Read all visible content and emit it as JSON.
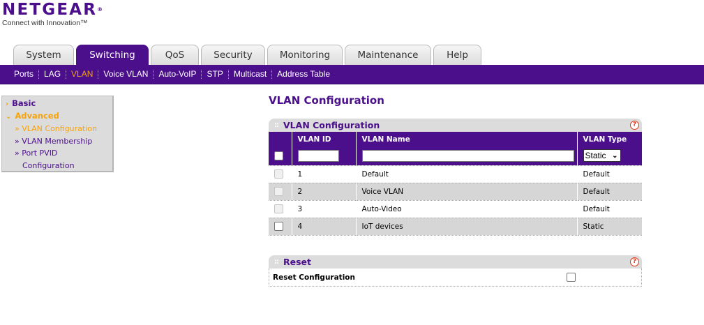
{
  "brand": {
    "name": "NETGEAR",
    "tagline": "Connect with Innovation™"
  },
  "tabs": [
    {
      "label": "System",
      "active": false
    },
    {
      "label": "Switching",
      "active": true
    },
    {
      "label": "QoS",
      "active": false
    },
    {
      "label": "Security",
      "active": false
    },
    {
      "label": "Monitoring",
      "active": false
    },
    {
      "label": "Maintenance",
      "active": false
    },
    {
      "label": "Help",
      "active": false
    }
  ],
  "subnav": [
    {
      "label": "Ports",
      "active": false
    },
    {
      "label": "LAG",
      "active": false
    },
    {
      "label": "VLAN",
      "active": true
    },
    {
      "label": "Voice VLAN",
      "active": false
    },
    {
      "label": "Auto-VoIP",
      "active": false
    },
    {
      "label": "STP",
      "active": false
    },
    {
      "label": "Multicast",
      "active": false
    },
    {
      "label": "Address Table",
      "active": false
    }
  ],
  "sidebar": {
    "basic": "Basic",
    "advanced": "Advanced",
    "items": [
      {
        "label": "» VLAN Configuration",
        "active": true
      },
      {
        "label": "» VLAN Membership",
        "active": false
      },
      {
        "label": "» Port PVID",
        "active": false
      },
      {
        "label": "Configuration",
        "active": false
      }
    ]
  },
  "page_title": "VLAN Configuration",
  "vlan_panel": {
    "title": "VLAN Configuration",
    "help": "?",
    "columns": [
      "",
      "VLAN ID",
      "VLAN Name",
      "VLAN Type"
    ],
    "new_row": {
      "vlan_id": "",
      "vlan_name": "",
      "vlan_type": "Static"
    },
    "rows": [
      {
        "id": "1",
        "name": "Default",
        "type": "Default",
        "editable": false
      },
      {
        "id": "2",
        "name": "Voice VLAN",
        "type": "Default",
        "editable": false
      },
      {
        "id": "3",
        "name": "Auto-Video",
        "type": "Default",
        "editable": false
      },
      {
        "id": "4",
        "name": "IoT devices",
        "type": "Static",
        "editable": true
      }
    ]
  },
  "reset_panel": {
    "title": "Reset",
    "help": "?",
    "label": "Reset Configuration",
    "checked": false
  },
  "colors": {
    "brand_purple": "#4b0f8c",
    "accent_orange": "#f7a30a"
  }
}
